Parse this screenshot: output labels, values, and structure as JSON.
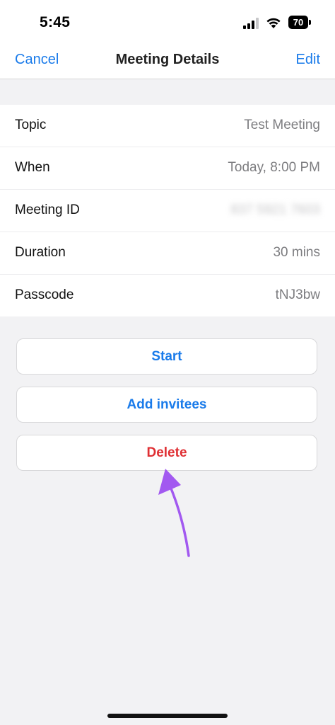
{
  "status_bar": {
    "time": "5:45",
    "battery_level": "70"
  },
  "nav": {
    "cancel_label": "Cancel",
    "title": "Meeting Details",
    "edit_label": "Edit"
  },
  "details": [
    {
      "label": "Topic",
      "value": "Test Meeting"
    },
    {
      "label": "When",
      "value": "Today, 8:00 PM"
    },
    {
      "label": "Meeting ID",
      "value": "837 5921 7603"
    },
    {
      "label": "Duration",
      "value": "30 mins"
    },
    {
      "label": "Passcode",
      "value": "tNJ3bw"
    }
  ],
  "actions": {
    "start_label": "Start",
    "add_invitees_label": "Add invitees",
    "delete_label": "Delete"
  },
  "colors": {
    "accent": "#1a7bea",
    "destructive": "#df2f33",
    "annotation": "#a259f0"
  }
}
